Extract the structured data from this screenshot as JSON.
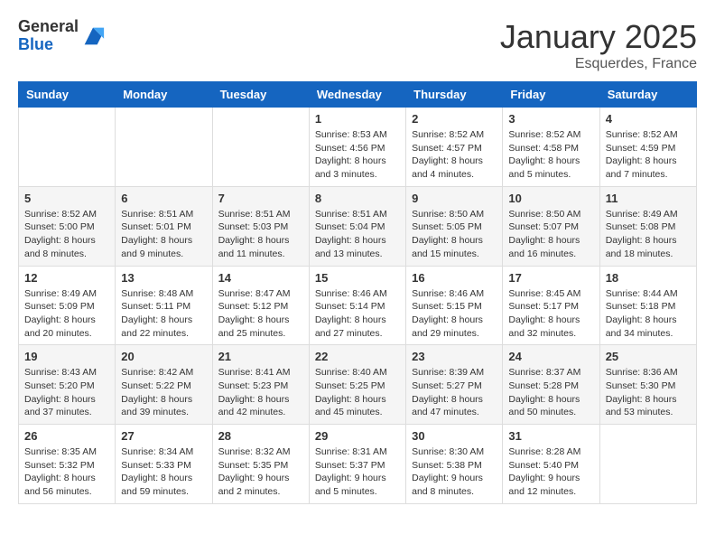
{
  "logo": {
    "general": "General",
    "blue": "Blue"
  },
  "header": {
    "month": "January 2025",
    "location": "Esquerdes, France"
  },
  "weekdays": [
    "Sunday",
    "Monday",
    "Tuesday",
    "Wednesday",
    "Thursday",
    "Friday",
    "Saturday"
  ],
  "weeks": [
    [
      {
        "day": "",
        "content": ""
      },
      {
        "day": "",
        "content": ""
      },
      {
        "day": "",
        "content": ""
      },
      {
        "day": "1",
        "content": "Sunrise: 8:53 AM\nSunset: 4:56 PM\nDaylight: 8 hours\nand 3 minutes."
      },
      {
        "day": "2",
        "content": "Sunrise: 8:52 AM\nSunset: 4:57 PM\nDaylight: 8 hours\nand 4 minutes."
      },
      {
        "day": "3",
        "content": "Sunrise: 8:52 AM\nSunset: 4:58 PM\nDaylight: 8 hours\nand 5 minutes."
      },
      {
        "day": "4",
        "content": "Sunrise: 8:52 AM\nSunset: 4:59 PM\nDaylight: 8 hours\nand 7 minutes."
      }
    ],
    [
      {
        "day": "5",
        "content": "Sunrise: 8:52 AM\nSunset: 5:00 PM\nDaylight: 8 hours\nand 8 minutes."
      },
      {
        "day": "6",
        "content": "Sunrise: 8:51 AM\nSunset: 5:01 PM\nDaylight: 8 hours\nand 9 minutes."
      },
      {
        "day": "7",
        "content": "Sunrise: 8:51 AM\nSunset: 5:03 PM\nDaylight: 8 hours\nand 11 minutes."
      },
      {
        "day": "8",
        "content": "Sunrise: 8:51 AM\nSunset: 5:04 PM\nDaylight: 8 hours\nand 13 minutes."
      },
      {
        "day": "9",
        "content": "Sunrise: 8:50 AM\nSunset: 5:05 PM\nDaylight: 8 hours\nand 15 minutes."
      },
      {
        "day": "10",
        "content": "Sunrise: 8:50 AM\nSunset: 5:07 PM\nDaylight: 8 hours\nand 16 minutes."
      },
      {
        "day": "11",
        "content": "Sunrise: 8:49 AM\nSunset: 5:08 PM\nDaylight: 8 hours\nand 18 minutes."
      }
    ],
    [
      {
        "day": "12",
        "content": "Sunrise: 8:49 AM\nSunset: 5:09 PM\nDaylight: 8 hours\nand 20 minutes."
      },
      {
        "day": "13",
        "content": "Sunrise: 8:48 AM\nSunset: 5:11 PM\nDaylight: 8 hours\nand 22 minutes."
      },
      {
        "day": "14",
        "content": "Sunrise: 8:47 AM\nSunset: 5:12 PM\nDaylight: 8 hours\nand 25 minutes."
      },
      {
        "day": "15",
        "content": "Sunrise: 8:46 AM\nSunset: 5:14 PM\nDaylight: 8 hours\nand 27 minutes."
      },
      {
        "day": "16",
        "content": "Sunrise: 8:46 AM\nSunset: 5:15 PM\nDaylight: 8 hours\nand 29 minutes."
      },
      {
        "day": "17",
        "content": "Sunrise: 8:45 AM\nSunset: 5:17 PM\nDaylight: 8 hours\nand 32 minutes."
      },
      {
        "day": "18",
        "content": "Sunrise: 8:44 AM\nSunset: 5:18 PM\nDaylight: 8 hours\nand 34 minutes."
      }
    ],
    [
      {
        "day": "19",
        "content": "Sunrise: 8:43 AM\nSunset: 5:20 PM\nDaylight: 8 hours\nand 37 minutes."
      },
      {
        "day": "20",
        "content": "Sunrise: 8:42 AM\nSunset: 5:22 PM\nDaylight: 8 hours\nand 39 minutes."
      },
      {
        "day": "21",
        "content": "Sunrise: 8:41 AM\nSunset: 5:23 PM\nDaylight: 8 hours\nand 42 minutes."
      },
      {
        "day": "22",
        "content": "Sunrise: 8:40 AM\nSunset: 5:25 PM\nDaylight: 8 hours\nand 45 minutes."
      },
      {
        "day": "23",
        "content": "Sunrise: 8:39 AM\nSunset: 5:27 PM\nDaylight: 8 hours\nand 47 minutes."
      },
      {
        "day": "24",
        "content": "Sunrise: 8:37 AM\nSunset: 5:28 PM\nDaylight: 8 hours\nand 50 minutes."
      },
      {
        "day": "25",
        "content": "Sunrise: 8:36 AM\nSunset: 5:30 PM\nDaylight: 8 hours\nand 53 minutes."
      }
    ],
    [
      {
        "day": "26",
        "content": "Sunrise: 8:35 AM\nSunset: 5:32 PM\nDaylight: 8 hours\nand 56 minutes."
      },
      {
        "day": "27",
        "content": "Sunrise: 8:34 AM\nSunset: 5:33 PM\nDaylight: 8 hours\nand 59 minutes."
      },
      {
        "day": "28",
        "content": "Sunrise: 8:32 AM\nSunset: 5:35 PM\nDaylight: 9 hours\nand 2 minutes."
      },
      {
        "day": "29",
        "content": "Sunrise: 8:31 AM\nSunset: 5:37 PM\nDaylight: 9 hours\nand 5 minutes."
      },
      {
        "day": "30",
        "content": "Sunrise: 8:30 AM\nSunset: 5:38 PM\nDaylight: 9 hours\nand 8 minutes."
      },
      {
        "day": "31",
        "content": "Sunrise: 8:28 AM\nSunset: 5:40 PM\nDaylight: 9 hours\nand 12 minutes."
      },
      {
        "day": "",
        "content": ""
      }
    ]
  ]
}
